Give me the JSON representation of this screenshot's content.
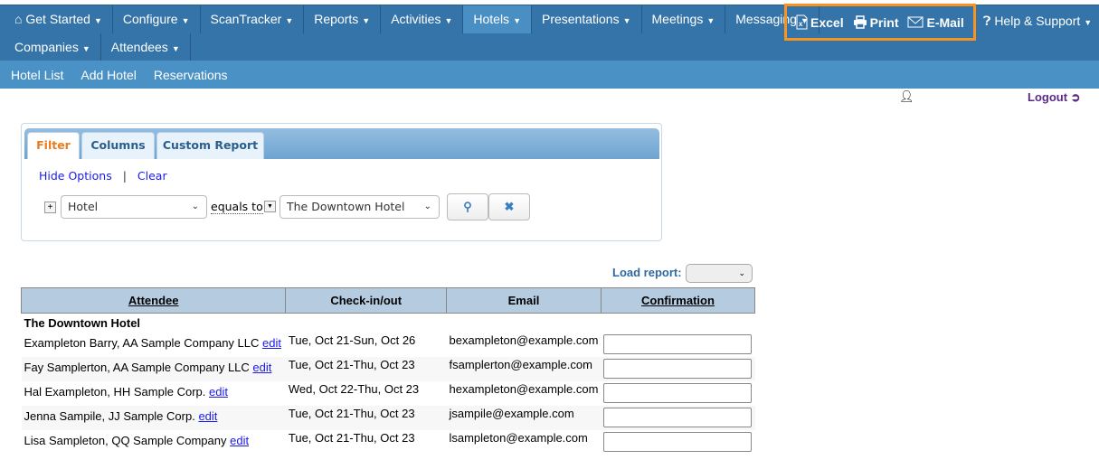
{
  "nav": {
    "row1": [
      {
        "label": "Get Started",
        "icon": "home-icon"
      },
      {
        "label": "Configure"
      },
      {
        "label": "ScanTracker"
      },
      {
        "label": "Reports"
      },
      {
        "label": "Activities"
      },
      {
        "label": "Hotels",
        "active": true
      },
      {
        "label": "Presentations"
      },
      {
        "label": "Meetings"
      },
      {
        "label": "Messaging"
      }
    ],
    "row2": [
      {
        "label": "Companies"
      },
      {
        "label": "Attendees"
      }
    ],
    "export": {
      "excel": "Excel",
      "print": "Print",
      "email": "E-Mail"
    },
    "help": "Help & Support"
  },
  "subnav": [
    "Hotel List",
    "Add Hotel",
    "Reservations"
  ],
  "user": {
    "logout": "Logout"
  },
  "filter": {
    "tabs": [
      "Filter",
      "Columns",
      "Custom Report"
    ],
    "hide_options": "Hide Options",
    "separator": "|",
    "clear": "Clear",
    "field": "Hotel",
    "operator": "equals to",
    "value": "The Downtown Hotel"
  },
  "load_report": "Load report:",
  "table": {
    "headers": [
      "Attendee",
      "Check-in/out",
      "Email",
      "Confirmation"
    ],
    "group": "The Downtown Hotel",
    "edit_label": "edit",
    "rows": [
      {
        "attendee": "Exampleton Barry, AA Sample Company LLC",
        "dates": "Tue, Oct 21-Sun, Oct 26",
        "email": "bexampleton@example.com",
        "confirmation": ""
      },
      {
        "attendee": "Fay Samplerton, AA Sample Company LLC",
        "dates": "Tue, Oct 21-Thu, Oct 23",
        "email": "fsamplerton@example.com",
        "confirmation": ""
      },
      {
        "attendee": "Hal Exampleton, HH Sample Corp.",
        "dates": "Wed, Oct 22-Thu, Oct 23",
        "email": "hexampleton@example.com",
        "confirmation": ""
      },
      {
        "attendee": "Jenna Sampile, JJ Sample Corp.",
        "dates": "Tue, Oct 21-Thu, Oct 23",
        "email": "jsampile@example.com",
        "confirmation": ""
      },
      {
        "attendee": "Lisa Sampleton, QQ Sample Company",
        "dates": "Tue, Oct 21-Thu, Oct 23",
        "email": "lsampleton@example.com",
        "confirmation": ""
      }
    ]
  },
  "colors": {
    "nav": "#3474a8",
    "subnav": "#4a92c5",
    "highlight": "#f7931e",
    "logout": "#5a2a8a"
  }
}
